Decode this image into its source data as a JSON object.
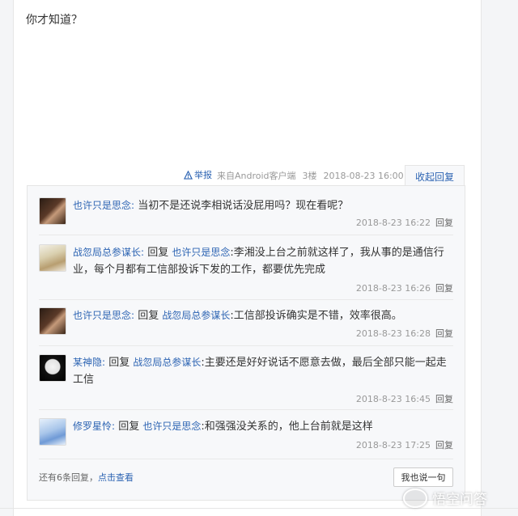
{
  "post": {
    "text": "你才知道？",
    "report_label": "举报",
    "source": "来自Android客户端",
    "floor": "3楼",
    "datetime": "2018-08-23 16:00",
    "collapse_label": "收起回复"
  },
  "comments": [
    {
      "user": "也许只是思念:",
      "reply_prefix": "",
      "reply_to": "",
      "text": "当初不是还说李相说话没屁用吗？现在看呢？",
      "time": "2018-8-23 16:22",
      "reply_label": "回复"
    },
    {
      "user": "战忽局总参谋长:",
      "reply_prefix": "回复",
      "reply_to": "也许只是思念",
      "text": ":李湘没上台之前就这样了，我从事的是通信行业，每个月都有工信部投诉下发的工作，都要优先完成",
      "time": "2018-8-23 16:26",
      "reply_label": "回复"
    },
    {
      "user": "也许只是思念:",
      "reply_prefix": "回复",
      "reply_to": "战忽局总参谋长",
      "text": ":工信部投诉确实是不错，效率很高。",
      "time": "2018-8-23 16:28",
      "reply_label": "回复"
    },
    {
      "user": "某神隐:",
      "reply_prefix": "回复",
      "reply_to": "战忽局总参谋长",
      "text": ":主要还是好好说话不愿意去做，最后全部只能一起走工信",
      "time": "2018-8-23 16:45",
      "reply_label": "回复"
    },
    {
      "user": "修罗星怜:",
      "reply_prefix": "回复",
      "reply_to": "也许只是思念",
      "text": ":和强强没关系的，他上台前就是这样",
      "time": "2018-8-23 17:25",
      "reply_label": "回复"
    }
  ],
  "footer": {
    "more_text": "还有6条回复，",
    "more_link": "点击查看",
    "say_button": "我也说一句"
  },
  "watermark": {
    "text": "悟空问答"
  },
  "colors": {
    "link": "#2d64b3",
    "meta": "#999999",
    "panel_bg": "#f7f8fa"
  }
}
